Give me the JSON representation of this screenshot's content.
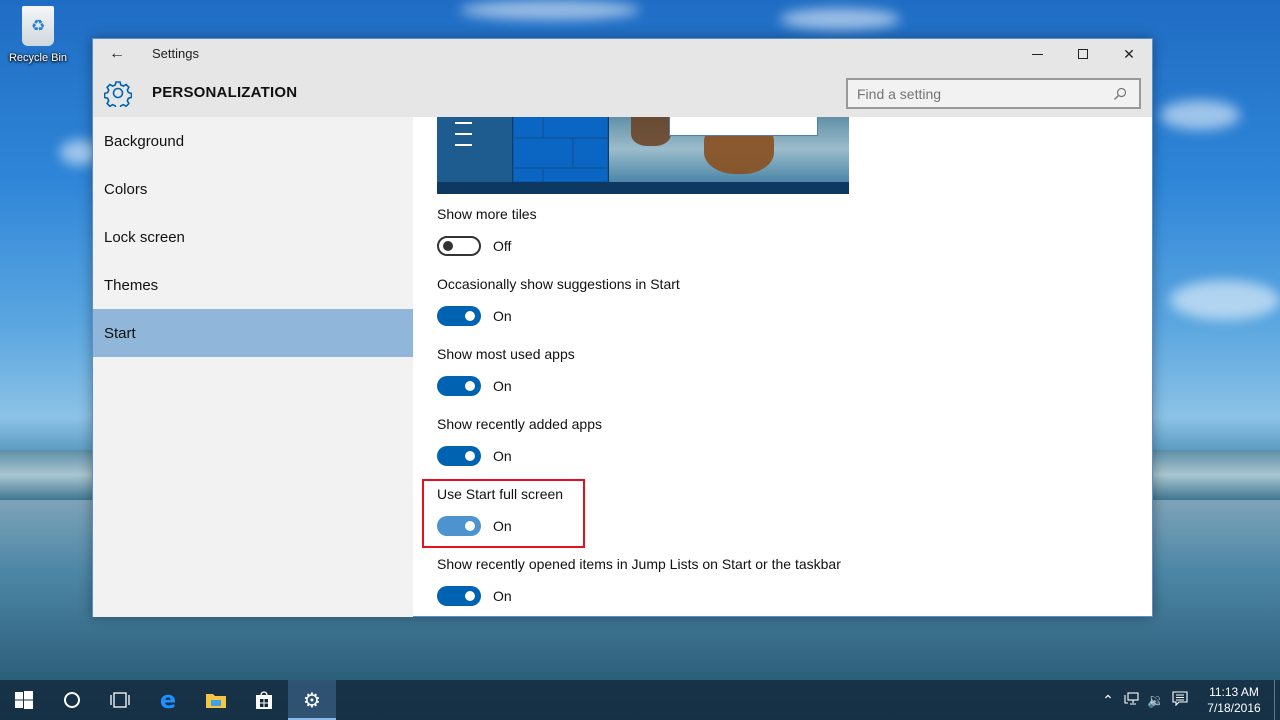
{
  "desktop": {
    "icons": [
      {
        "label": "Recycle Bin",
        "icon": "recycle-bin-icon"
      }
    ]
  },
  "window": {
    "title": "Settings",
    "back_icon": "back-arrow-icon",
    "controls": {
      "minimize": "minimize-icon",
      "maximize": "maximize-icon",
      "close": "close-icon"
    },
    "header": {
      "section_title": "PERSONALIZATION",
      "section_icon": "gear-icon",
      "search": {
        "placeholder": "Find a setting",
        "value": "",
        "icon": "search-icon"
      }
    },
    "sidebar": {
      "items": [
        {
          "label": "Background",
          "active": false
        },
        {
          "label": "Colors",
          "active": false
        },
        {
          "label": "Lock screen",
          "active": false
        },
        {
          "label": "Themes",
          "active": false
        },
        {
          "label": "Start",
          "active": true
        }
      ]
    },
    "content": {
      "settings": [
        {
          "label": "Show more tiles",
          "state": "Off",
          "on": false
        },
        {
          "label": "Occasionally show suggestions in Start",
          "state": "On",
          "on": true
        },
        {
          "label": "Show most used apps",
          "state": "On",
          "on": true
        },
        {
          "label": "Show recently added apps",
          "state": "On",
          "on": true
        },
        {
          "label": "Use Start full screen",
          "state": "On",
          "on": true,
          "highlighted": true
        },
        {
          "label": "Show recently opened items in Jump Lists on Start or the taskbar",
          "state": "On",
          "on": true
        }
      ],
      "highlight_color": "#e8101e",
      "accent_color": "#0063b1"
    }
  },
  "taskbar": {
    "buttons": [
      {
        "name": "start",
        "icon": "windows-logo-icon"
      },
      {
        "name": "cortana",
        "icon": "cortana-circle-icon"
      },
      {
        "name": "task-view",
        "icon": "task-view-icon"
      },
      {
        "name": "edge",
        "icon": "edge-icon"
      },
      {
        "name": "file-explorer",
        "icon": "folder-icon"
      },
      {
        "name": "store",
        "icon": "store-bag-icon"
      },
      {
        "name": "settings",
        "icon": "gear-icon",
        "active": true
      }
    ],
    "tray": {
      "icons": [
        "chevron-up-icon",
        "network-icon",
        "volume-icon",
        "action-center-icon"
      ],
      "time": "11:13 AM",
      "date": "7/18/2016"
    }
  }
}
